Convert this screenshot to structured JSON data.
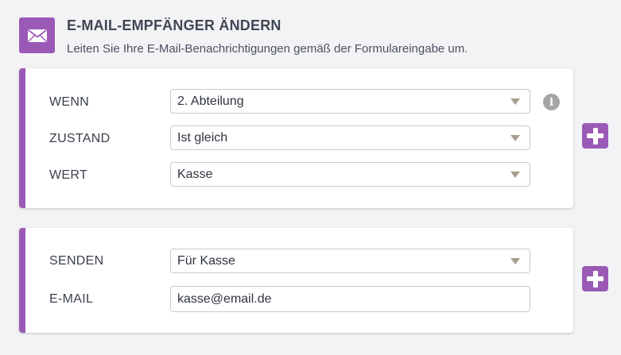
{
  "header": {
    "icon": "envelope-icon",
    "title": "E-MAIL-EMPFÄNGER ÄNDERN",
    "subtitle": "Leiten Sie Ihre E-Mail-Benachrichtigungen gemäß der Formulareingabe um."
  },
  "condition": {
    "if_label": "WENN",
    "if_value": "2. Abteilung",
    "state_label": "ZUSTAND",
    "state_value": "Ist gleich",
    "value_label": "WERT",
    "value_value": "Kasse"
  },
  "action": {
    "send_label": "SENDEN",
    "send_value": "Für Kasse",
    "email_label": "E-MAIL",
    "email_value": "kasse@email.de"
  },
  "colors": {
    "accent": "#9b59b6",
    "background": "#f3f3f5"
  }
}
